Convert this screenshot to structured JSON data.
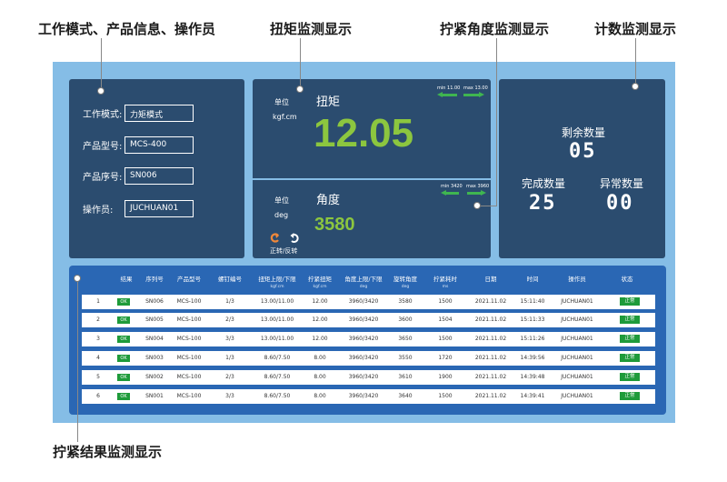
{
  "callouts": {
    "mode_info": "工作模式、产品信息、操作员",
    "torque": "扭矩监测显示",
    "angle": "拧紧角度监测显示",
    "count": "计数监测显示",
    "result": "拧紧结果监测显示"
  },
  "info_panel": {
    "mode_label": "工作模式:",
    "mode_value": "力矩模式",
    "model_label": "产品型号:",
    "model_value": "MCS-400",
    "serial_label": "产品序号:",
    "serial_value": "SN006",
    "operator_label": "操作员:",
    "operator_value": "JUCHUAN01"
  },
  "torque_panel": {
    "unit_label": "单位",
    "unit_value": "kgf.cm",
    "title": "扭矩",
    "value": "12.05",
    "min_label": "min 11.00",
    "max_label": "max 13.00"
  },
  "angle_panel": {
    "unit_label": "单位",
    "unit_value": "deg",
    "title": "角度",
    "value": "3580",
    "min_label": "min 3420",
    "max_label": "max 3960",
    "direction_label": "正转/反转"
  },
  "count_panel": {
    "remaining_label": "剩余数量",
    "remaining_value": "05",
    "done_label": "完成数量",
    "done_value": "25",
    "abnormal_label": "异常数量",
    "abnormal_value": "00"
  },
  "table": {
    "headers": [
      "结果",
      "序列号",
      "产品型号",
      "螺钉编号",
      "扭矩上限/下限",
      "拧紧扭矩",
      "角度上限/下限",
      "旋转角度",
      "拧紧耗时",
      "日期",
      "时间",
      "操作员",
      "状态"
    ],
    "header_units": [
      "",
      "",
      "",
      "",
      "kgf.cm",
      "kgf.cm",
      "deg",
      "deg",
      "ms",
      "",
      "",
      "",
      ""
    ],
    "rows": [
      {
        "idx": "1",
        "result": "OK",
        "serial": "SN006",
        "model": "MCS-100",
        "screw": "1/3",
        "torque_range": "13.00/11.00",
        "torque": "12.00",
        "angle_range": "3960/3420",
        "angle": "3580",
        "time_ms": "1500",
        "date": "2021.11.02",
        "time": "15:11:40",
        "operator": "JUCHUAN01",
        "status": "正常"
      },
      {
        "idx": "2",
        "result": "OK",
        "serial": "SN005",
        "model": "MCS-100",
        "screw": "2/3",
        "torque_range": "13.00/11.00",
        "torque": "12.00",
        "angle_range": "3960/3420",
        "angle": "3600",
        "time_ms": "1504",
        "date": "2021.11.02",
        "time": "15:11:33",
        "operator": "JUCHUAN01",
        "status": "正常"
      },
      {
        "idx": "3",
        "result": "OK",
        "serial": "SN004",
        "model": "MCS-100",
        "screw": "3/3",
        "torque_range": "13.00/11.00",
        "torque": "12.00",
        "angle_range": "3960/3420",
        "angle": "3650",
        "time_ms": "1500",
        "date": "2021.11.02",
        "time": "15:11:26",
        "operator": "JUCHUAN01",
        "status": "正常"
      },
      {
        "idx": "4",
        "result": "OK",
        "serial": "SN003",
        "model": "MCS-100",
        "screw": "1/3",
        "torque_range": "8.60/7.50",
        "torque": "8.00",
        "angle_range": "3960/3420",
        "angle": "3550",
        "time_ms": "1720",
        "date": "2021.11.02",
        "time": "14:39:56",
        "operator": "JUCHUAN01",
        "status": "正常"
      },
      {
        "idx": "5",
        "result": "OK",
        "serial": "SN002",
        "model": "MCS-100",
        "screw": "2/3",
        "torque_range": "8.60/7.50",
        "torque": "8.00",
        "angle_range": "3960/3420",
        "angle": "3610",
        "time_ms": "1900",
        "date": "2021.11.02",
        "time": "14:39:48",
        "operator": "JUCHUAN01",
        "status": "正常"
      },
      {
        "idx": "6",
        "result": "OK",
        "serial": "SN001",
        "model": "MCS-100",
        "screw": "3/3",
        "torque_range": "8.60/7.50",
        "torque": "8.00",
        "angle_range": "3960/3420",
        "angle": "3640",
        "time_ms": "1500",
        "date": "2021.11.02",
        "time": "14:39:41",
        "operator": "JUCHUAN01",
        "status": "正常"
      }
    ]
  },
  "colors": {
    "frame_bg": "#85bde6",
    "panel_bg": "#2b4c6f",
    "table_bg": "#2a67b4",
    "value_green": "#8cc63f",
    "status_green": "#1e9b3a",
    "reverse_orange": "#f0883a"
  }
}
